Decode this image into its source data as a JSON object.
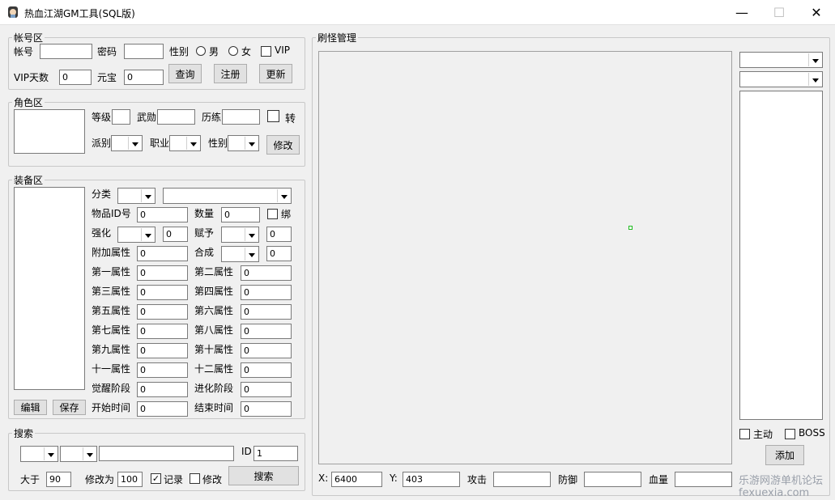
{
  "window": {
    "title": "热血江湖GM工具(SQL版)",
    "minimize": "—",
    "maximize": "☐",
    "close": "✕"
  },
  "account": {
    "group": "帐号区",
    "account_label": "帐号",
    "account_value": "",
    "password_label": "密码",
    "password_value": "",
    "gender_label": "性别",
    "male": "男",
    "female": "女",
    "vip": "VIP",
    "vip_days_label": "VIP天数",
    "vip_days_value": "0",
    "yuanbao_label": "元宝",
    "yuanbao_value": "0",
    "query": "查询",
    "register": "注册",
    "update": "更新"
  },
  "role": {
    "group": "角色区",
    "level": "等级",
    "wuxun": "武勋",
    "lilian": "历练",
    "zhuan": "转",
    "faction": "派别",
    "job": "职业",
    "gender": "性别",
    "modify": "修改"
  },
  "equip": {
    "group": "装备区",
    "category": "分类",
    "item_id": "物品ID号",
    "item_id_value": "0",
    "quantity": "数量",
    "quantity_value": "0",
    "bind": "绑",
    "enhance": "强化",
    "enhance_value": "0",
    "fuyu": "赋予",
    "fuyu_value": "0",
    "extra_attr": "附加属性",
    "extra_attr_value": "0",
    "compose": "合成",
    "compose_value": "0",
    "attrs": [
      {
        "l": "第一属性",
        "v": "0",
        "r": "第二属性",
        "rv": "0"
      },
      {
        "l": "第三属性",
        "v": "0",
        "r": "第四属性",
        "rv": "0"
      },
      {
        "l": "第五属性",
        "v": "0",
        "r": "第六属性",
        "rv": "0"
      },
      {
        "l": "第七属性",
        "v": "0",
        "r": "第八属性",
        "rv": "0"
      },
      {
        "l": "第九属性",
        "v": "0",
        "r": "第十属性",
        "rv": "0"
      },
      {
        "l": "十一属性",
        "v": "0",
        "r": "十二属性",
        "rv": "0"
      },
      {
        "l": "觉醒阶段",
        "v": "0",
        "r": "进化阶段",
        "rv": "0"
      },
      {
        "l": "开始时间",
        "v": "0",
        "r": "结束时间",
        "rv": "0"
      }
    ],
    "edit": "编辑",
    "save": "保存"
  },
  "search": {
    "group": "搜索",
    "id_label": "ID",
    "id_value": "1",
    "greater_label": "大于",
    "greater_value": "90",
    "modify_to_label": "修改为",
    "modify_to_value": "100",
    "record": "记录",
    "modify": "修改",
    "search_btn": "搜索"
  },
  "spawn": {
    "group": "刷怪管理",
    "x_label": "X:",
    "x_value": "6400",
    "y_label": "Y:",
    "y_value": "403",
    "attack": "攻击",
    "defense": "防御",
    "hp": "血量",
    "active": "主动",
    "boss": "BOSS",
    "add": "添加"
  },
  "watermark": "乐游网游单机论坛 fexuexia.com"
}
